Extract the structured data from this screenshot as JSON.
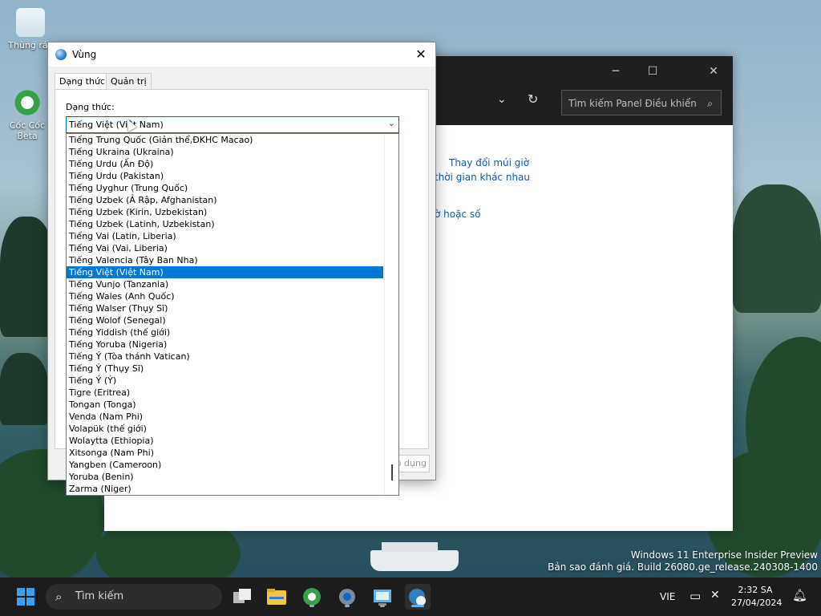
{
  "desktop": {
    "icons": [
      {
        "label": "Thùng rác"
      },
      {
        "label": "Cốc Cốc Beta",
        "badge": "BETA"
      }
    ]
  },
  "control_panel": {
    "search_placeholder": "Tìm kiếm Panel Điều khiển",
    "links": [
      "Thay đổi múi giờ",
      "thời gian khác nhau",
      "ờ hoặc số"
    ]
  },
  "dialog": {
    "title": "Vùng",
    "tabs": [
      {
        "label": "Dạng thức",
        "active": true
      },
      {
        "label": "Quản trị",
        "active": false
      }
    ],
    "format_label": "Dạng thức:",
    "selected_value": "Tiếng Việt (Việt Nam)",
    "apply_label": "Áp dụng",
    "dropdown_items": [
      "Tiếng Trung Quốc (Giản thể,ĐKHC Macao)",
      "Tiếng Ukraina (Ukraina)",
      "Tiếng Urdu (Ấn Độ)",
      "Tiếng Urdu (Pakistan)",
      "Tiếng Uyghur (Trung Quốc)",
      "Tiếng Uzbek (Ả Rập, Afghanistan)",
      "Tiếng Uzbek (Kirin, Uzbekistan)",
      "Tiếng Uzbek (Latinh, Uzbekistan)",
      "Tiếng Vai (Latin, Liberia)",
      "Tiếng Vai (Vai, Liberia)",
      "Tiếng Valencia (Tây Ban Nha)",
      "Tiếng Việt (Việt Nam)",
      "Tiếng Vunjo (Tanzania)",
      "Tiếng Wales (Anh Quốc)",
      "Tiếng Walser (Thụy Sĩ)",
      "Tiếng Wolof (Senegal)",
      "Tiếng Yiddish (thế giới)",
      "Tiếng Yoruba (Nigeria)",
      "Tiếng Ý (Tòa thánh Vatican)",
      "Tiếng Ý (Thụy Sĩ)",
      "Tiếng Ý (Ý)",
      "Tigre (Eritrea)",
      "Tongan (Tonga)",
      "Venda (Nam Phi)",
      "Volapük (thế giới)",
      "Wolaytta (Ethiopia)",
      "Xitsonga (Nam Phi)",
      "Yangben (Cameroon)",
      "Yoruba (Benin)",
      "Zarma (Niger)"
    ],
    "selected_index": 11
  },
  "watermark": {
    "line1": "Windows 11 Enterprise Insider Preview",
    "line2": "Bản sao đánh giá. Build 26080.ge_release.240308-1400"
  },
  "taskbar": {
    "search_label": "Tìm kiếm",
    "language": "VIE",
    "time": "2:32 SA",
    "date": "27/04/2024",
    "apps": [
      "task-view",
      "file-explorer",
      "coc-coc-browser",
      "settings",
      "control-panel",
      "region-settings"
    ]
  },
  "colors": {
    "accent": "#0078d7",
    "taskbar_bg": "#1c1c1c",
    "link": "#0b5cad"
  }
}
